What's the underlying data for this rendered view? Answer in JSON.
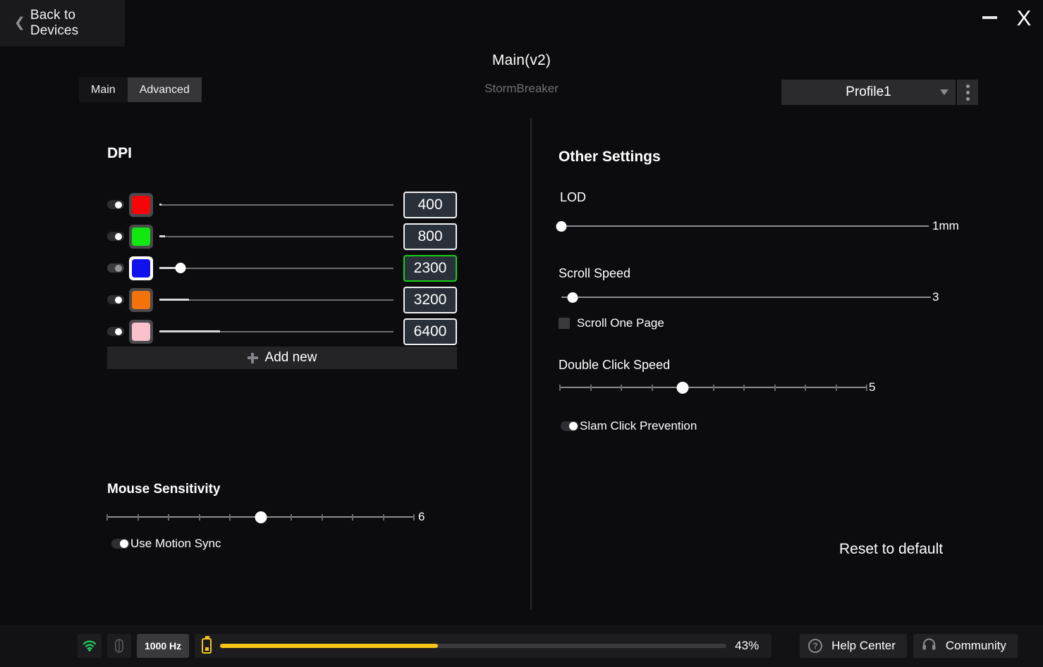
{
  "titlebar": {
    "back_label": "Back to Devices",
    "back_icon": "chevron-left-icon",
    "minimize_icon": "minimize-icon",
    "close_label": "X"
  },
  "header": {
    "device_title": "Main(v2)",
    "device_subtitle": "StormBreaker",
    "tabs": [
      {
        "label": "Main",
        "active": false
      },
      {
        "label": "Advanced",
        "active": true
      }
    ],
    "profile": {
      "selected": "Profile1",
      "caret_icon": "chevron-down-icon",
      "menu_icon": "kebab-menu-icon"
    }
  },
  "dpi": {
    "heading": "DPI",
    "rows": [
      {
        "value": "400",
        "color": "#f50505",
        "enabled": true,
        "selected": false,
        "fill_pct": 1.0
      },
      {
        "value": "800",
        "color": "#10e810",
        "enabled": true,
        "selected": false,
        "fill_pct": 2.5
      },
      {
        "value": "2300",
        "color": "#1111f0",
        "enabled": true,
        "selected": true,
        "fill_pct": 9.0
      },
      {
        "value": "3200",
        "color": "#f47208",
        "enabled": true,
        "selected": false,
        "fill_pct": 12.5
      },
      {
        "value": "6400",
        "color": "#fac1cd",
        "enabled": true,
        "selected": false,
        "fill_pct": 26.0
      }
    ],
    "add_new_label": "Add new",
    "add_new_icon": "plus-icon"
  },
  "sensitivity": {
    "label": "Mouse Sensitivity",
    "value": "6",
    "thumb_pct": 50.0,
    "ticks": 10,
    "motion_sync": {
      "label": "Use Motion Sync",
      "on": true
    }
  },
  "other_settings": {
    "heading": "Other Settings",
    "lod": {
      "label": "LOD",
      "value": "1mm",
      "thumb_pct": 0.0
    },
    "scroll_speed": {
      "label": "Scroll Speed",
      "value": "3",
      "thumb_pct": 3.0
    },
    "scroll_one_page": {
      "label": "Scroll One Page",
      "checked": false
    },
    "double_click_speed": {
      "label": "Double Click Speed",
      "value": "5",
      "thumb_pct": 40.0,
      "ticks": 10
    },
    "slam_click_prevention": {
      "label": "Slam Click Prevention",
      "on": true
    },
    "reset_label": "Reset to default"
  },
  "statusbar": {
    "wifi_icon": "wifi-icon",
    "mouse_icon": "mouse-icon",
    "polling_rate": "1000 Hz",
    "battery_icon": "battery-icon",
    "battery_percent": "43%",
    "battery_fill_pct": 43,
    "help_label": "Help Center",
    "help_icon": "question-circle-icon",
    "community_label": "Community",
    "community_icon": "headset-icon"
  },
  "colors": {
    "accent_green": "#17cf17",
    "battery_yellow": "#f5c518",
    "wifi_green": "#1fd65f"
  }
}
